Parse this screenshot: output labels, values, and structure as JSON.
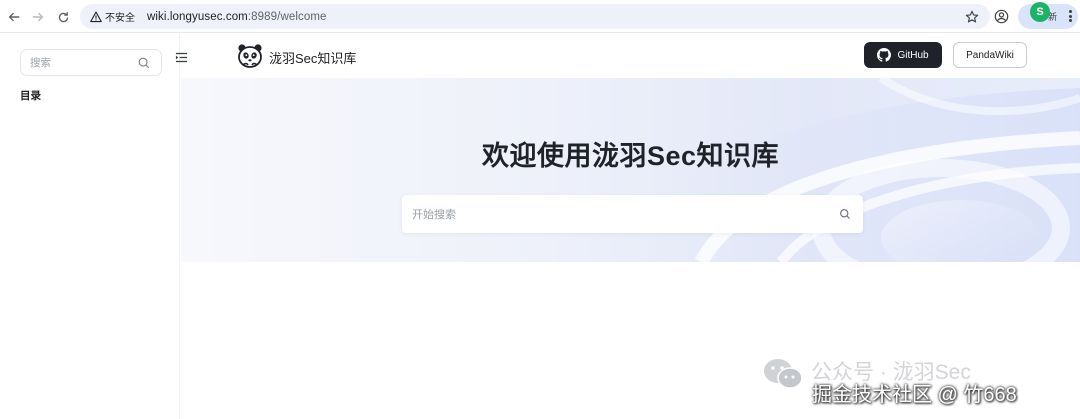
{
  "browser": {
    "insecure_label": "不安全",
    "url_host": "wiki.longyusec.com",
    "url_rest": ":8989/welcome",
    "extension_label": "新"
  },
  "sidebar": {
    "search_placeholder": "搜索",
    "toc_title": "目录"
  },
  "header": {
    "site_name": "泷羽Sec知识库",
    "github_label": "GitHub",
    "pandawiki_label": "PandaWiki"
  },
  "hero": {
    "title": "欢迎使用泷羽Sec知识库",
    "search_placeholder": "开始搜索"
  },
  "watermark": {
    "line1": "公众号 · 泷羽Sec",
    "line2": "掘金技术社区 @ 竹668"
  },
  "colors": {
    "header_button_dark": "#1f2329",
    "extension_badge": "#1db366",
    "omnibox_bg": "#eef1f9"
  }
}
